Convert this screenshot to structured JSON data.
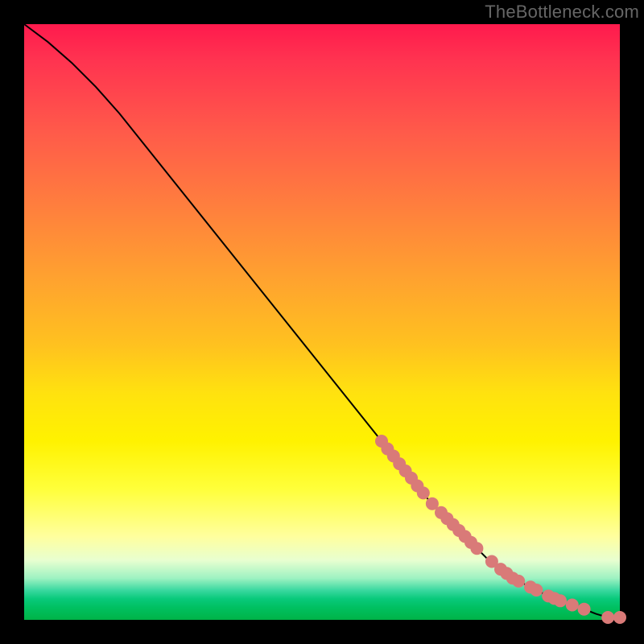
{
  "watermark": "TheBottleneck.com",
  "colors": {
    "background": "#000000",
    "curve_stroke": "#000000",
    "marker_fill": "#d97a78",
    "marker_stroke": "#b95a56"
  },
  "chart_data": {
    "type": "line",
    "title": "",
    "xlabel": "",
    "ylabel": "",
    "xlim": [
      0,
      100
    ],
    "ylim": [
      0,
      100
    ],
    "grid": false,
    "legend": false,
    "series": [
      {
        "name": "curve",
        "x": [
          0,
          4,
          8,
          12,
          16,
          20,
          24,
          28,
          32,
          36,
          40,
          44,
          48,
          52,
          56,
          60,
          64,
          66,
          68,
          70,
          72,
          74,
          76,
          78,
          80,
          82,
          84,
          86,
          88,
          90,
          92,
          94,
          96,
          98,
          100
        ],
        "y": [
          100,
          97,
          93.5,
          89.5,
          85,
          80,
          75,
          70,
          65,
          60,
          55,
          50,
          45,
          40,
          35,
          30,
          25,
          22.5,
          20,
          18,
          16,
          14,
          12,
          10,
          8.5,
          7,
          6,
          5,
          4,
          3.2,
          2.5,
          1.8,
          1.0,
          0.4,
          0.4
        ]
      }
    ],
    "markers": [
      {
        "x": 60.0,
        "y": 30.0
      },
      {
        "x": 61.0,
        "y": 28.7
      },
      {
        "x": 62.0,
        "y": 27.5
      },
      {
        "x": 63.0,
        "y": 26.2
      },
      {
        "x": 64.0,
        "y": 25.0
      },
      {
        "x": 65.0,
        "y": 23.8
      },
      {
        "x": 66.0,
        "y": 22.5
      },
      {
        "x": 67.0,
        "y": 21.3
      },
      {
        "x": 68.5,
        "y": 19.5
      },
      {
        "x": 70.0,
        "y": 18.0
      },
      {
        "x": 71.0,
        "y": 17.0
      },
      {
        "x": 72.0,
        "y": 16.0
      },
      {
        "x": 73.0,
        "y": 15.0
      },
      {
        "x": 74.0,
        "y": 14.0
      },
      {
        "x": 75.0,
        "y": 13.0
      },
      {
        "x": 76.0,
        "y": 12.0
      },
      {
        "x": 78.5,
        "y": 9.8
      },
      {
        "x": 80.0,
        "y": 8.5
      },
      {
        "x": 81.0,
        "y": 7.8
      },
      {
        "x": 82.0,
        "y": 7.0
      },
      {
        "x": 83.0,
        "y": 6.5
      },
      {
        "x": 85.0,
        "y": 5.5
      },
      {
        "x": 86.0,
        "y": 5.0
      },
      {
        "x": 88.0,
        "y": 4.0
      },
      {
        "x": 89.0,
        "y": 3.6
      },
      {
        "x": 90.0,
        "y": 3.2
      },
      {
        "x": 92.0,
        "y": 2.5
      },
      {
        "x": 94.0,
        "y": 1.8
      },
      {
        "x": 98.0,
        "y": 0.4
      },
      {
        "x": 100.0,
        "y": 0.4
      }
    ]
  }
}
